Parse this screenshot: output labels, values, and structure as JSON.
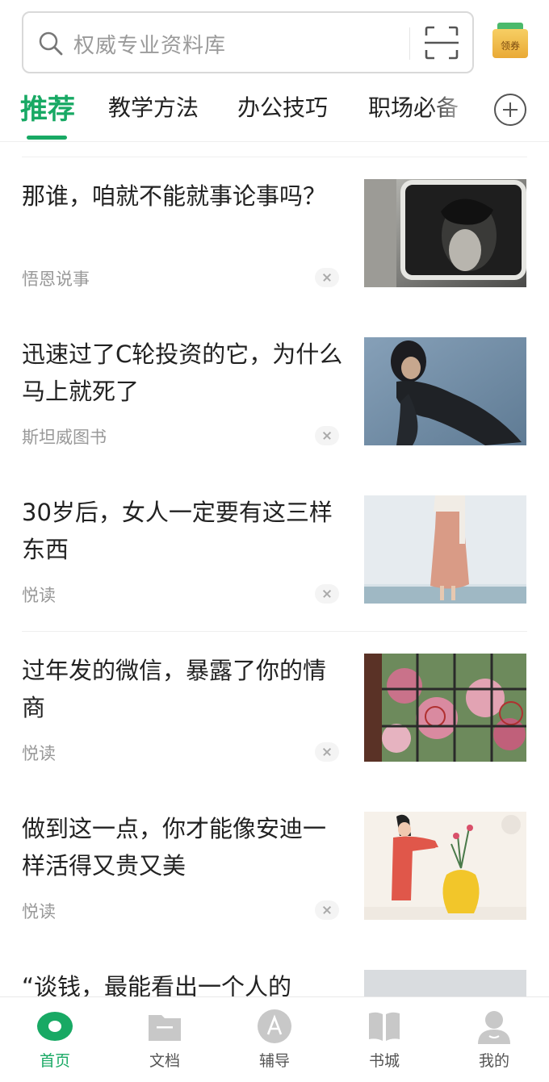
{
  "search": {
    "placeholder": "权威专业资料库"
  },
  "coupon": {
    "label": "领券"
  },
  "tabs": [
    {
      "label": "推荐",
      "active": true
    },
    {
      "label": "教学方法"
    },
    {
      "label": "办公技巧"
    },
    {
      "label": "职场必备"
    }
  ],
  "articles": [
    {
      "title": "那谁，咱就不能就事论事吗？",
      "source": "悟恩说事"
    },
    {
      "title": "迅速过了C轮投资的它，为什么马上就死了",
      "source": "斯坦威图书"
    },
    {
      "title": "30岁后，女人一定要有这三样东西",
      "source": "悦读"
    },
    {
      "title": "过年发的微信，暴露了你的情商",
      "source": "悦读"
    },
    {
      "title": "做到这一点，你才能像安迪一样活得又贵又美",
      "source": "悦读"
    },
    {
      "title": "“谈钱，最能看出一个人的",
      "source": ""
    }
  ],
  "bottom_nav": [
    {
      "label": "首页",
      "icon": "home-icon",
      "active": true
    },
    {
      "label": "文档",
      "icon": "folder-icon"
    },
    {
      "label": "辅导",
      "icon": "tutor-icon"
    },
    {
      "label": "书城",
      "icon": "book-icon"
    },
    {
      "label": "我的",
      "icon": "profile-icon"
    }
  ],
  "colors": {
    "accent": "#18a964",
    "text": "#222222",
    "muted": "#999999"
  }
}
